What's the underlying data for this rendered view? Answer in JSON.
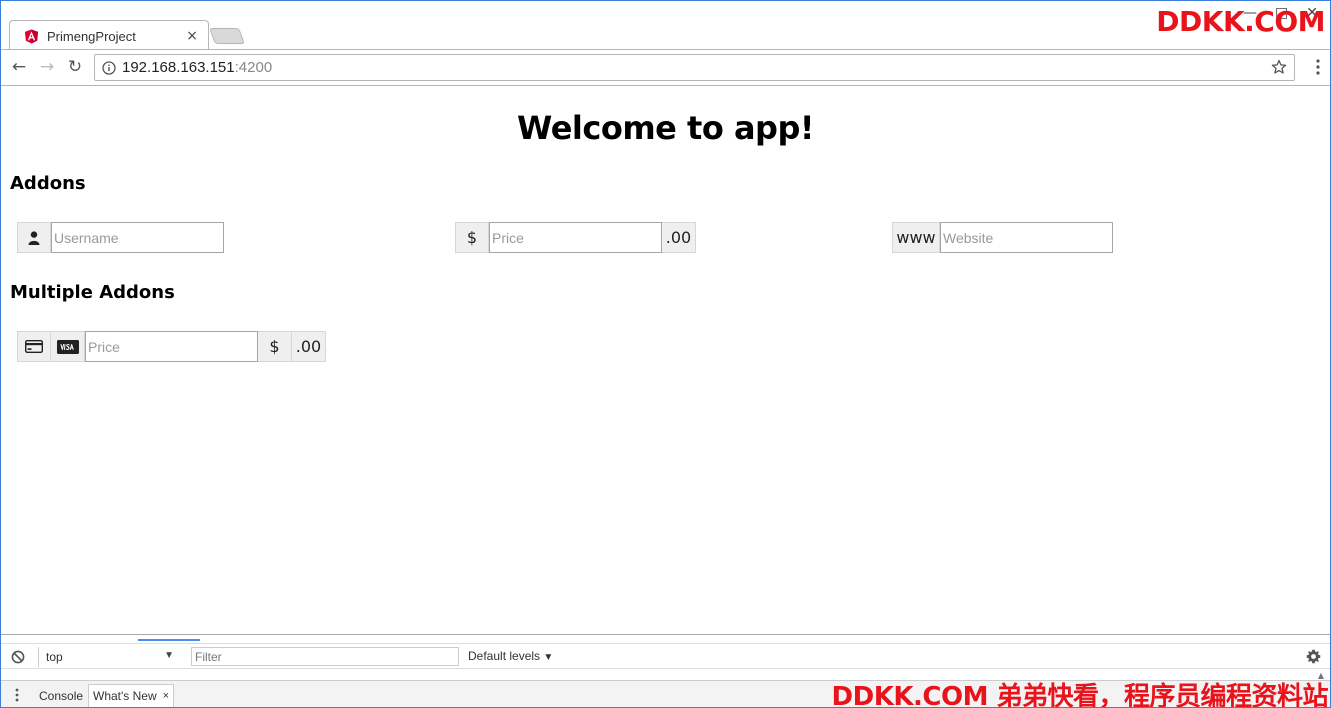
{
  "browser": {
    "tab_title": "PrimengProject",
    "tab_close": "×",
    "url_host": "192.168.163.151",
    "url_port": ":4200"
  },
  "page": {
    "title": "Welcome to app!",
    "section_addons": "Addons",
    "section_multiple": "Multiple Addons",
    "addons": {
      "username_placeholder": "Username",
      "price_prefix": "$",
      "price_placeholder": "Price",
      "price_suffix": ".00",
      "website_prefix": "www",
      "website_placeholder": "Website"
    },
    "multiple": {
      "price_placeholder": "Price",
      "dollar": "$",
      "cents": ".00"
    }
  },
  "devtools": {
    "context": "top",
    "filter_placeholder": "Filter",
    "levels": "Default levels",
    "tab_console": "Console",
    "tab_whats_new": "What's New",
    "tab_close": "×"
  },
  "watermark": {
    "top": "DDKK.COM",
    "bottom": "DDKK.COM 弟弟快看，程序员编程资料站"
  },
  "colors": {
    "accent": "#4b8ef2",
    "watermark": "#e8131b",
    "window_border": "#3a7fd8"
  }
}
